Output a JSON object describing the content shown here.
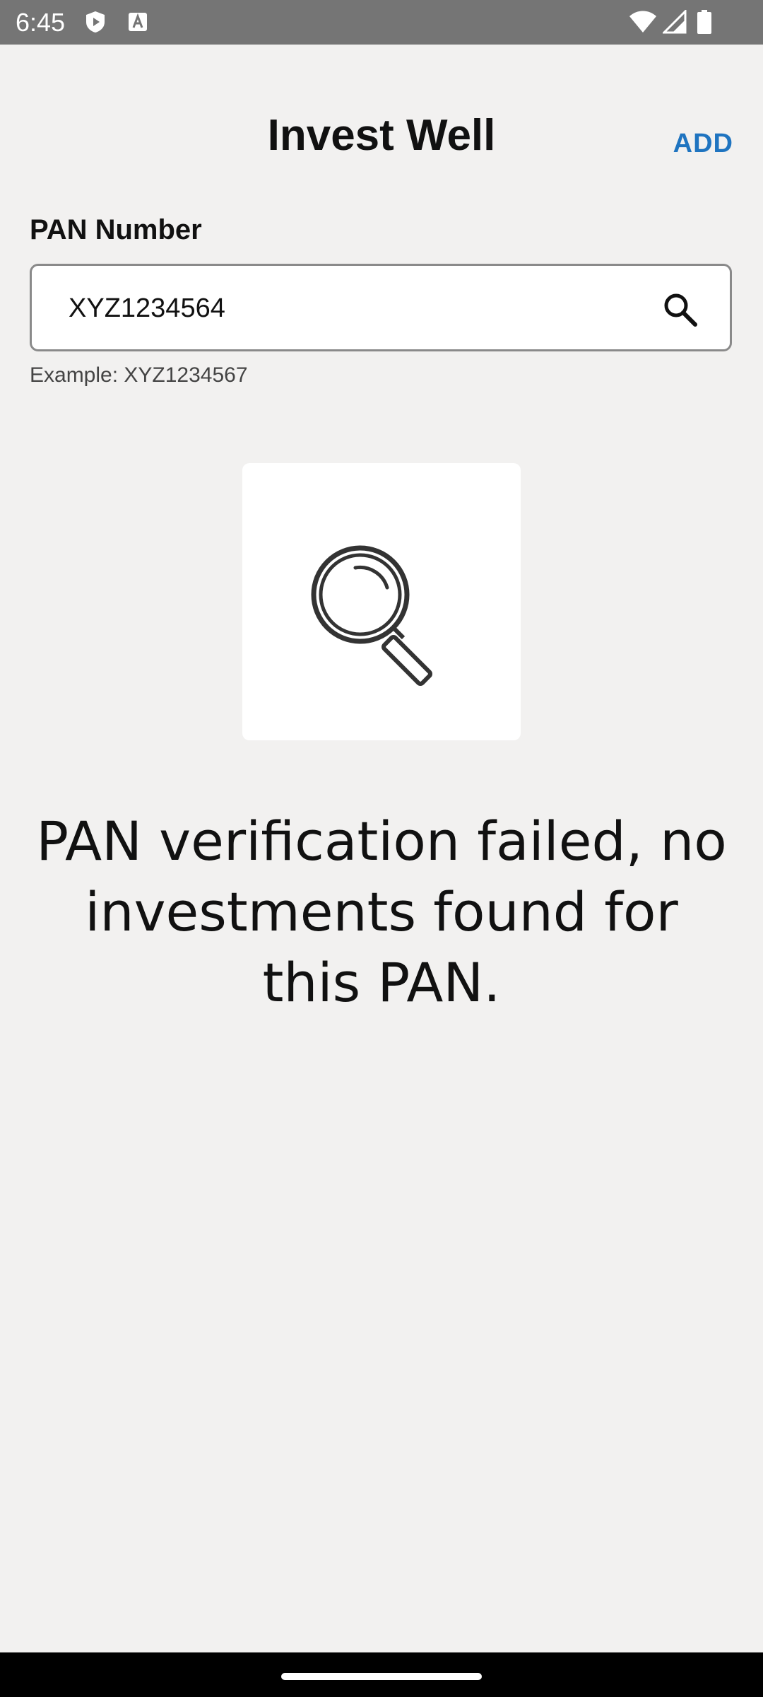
{
  "status_bar": {
    "time": "6:45",
    "icons": [
      "shield-play-icon",
      "font-a-icon",
      "wifi-icon",
      "signal-icon",
      "battery-icon"
    ]
  },
  "header": {
    "title": "Invest Well",
    "add_label": "ADD"
  },
  "form": {
    "label": "PAN Number",
    "value": "XYZ1234564",
    "helper": "Example: XYZ1234567",
    "search_icon": "search-icon"
  },
  "result": {
    "illustration_icon": "magnifying-glass-icon",
    "message": "PAN verification failed, no investments found for this PAN."
  },
  "colors": {
    "accent": "#1f74c0",
    "background": "#f2f1f0",
    "status_bar": "#757575"
  }
}
